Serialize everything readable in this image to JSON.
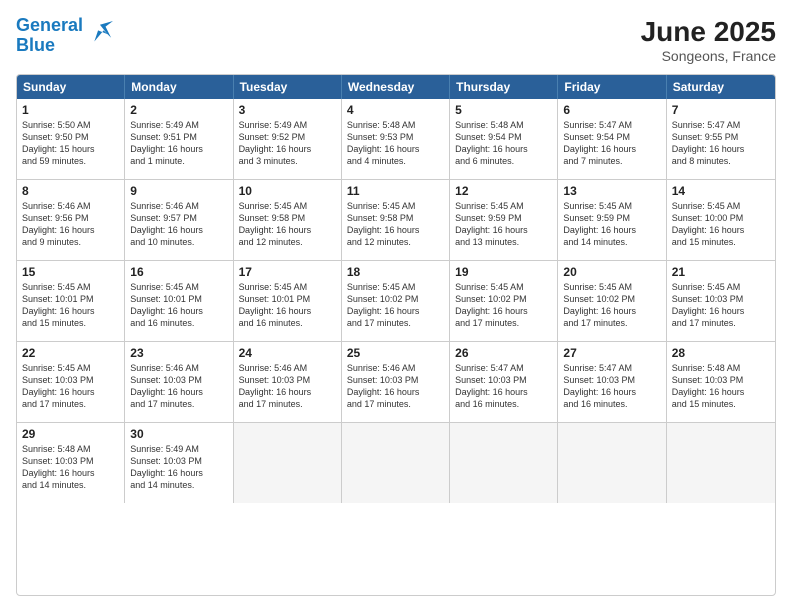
{
  "header": {
    "logo_line1": "General",
    "logo_line2": "Blue",
    "month": "June 2025",
    "location": "Songeons, France"
  },
  "days_of_week": [
    "Sunday",
    "Monday",
    "Tuesday",
    "Wednesday",
    "Thursday",
    "Friday",
    "Saturday"
  ],
  "weeks": [
    [
      {
        "day": "1",
        "lines": [
          "Sunrise: 5:50 AM",
          "Sunset: 9:50 PM",
          "Daylight: 15 hours",
          "and 59 minutes."
        ]
      },
      {
        "day": "2",
        "lines": [
          "Sunrise: 5:49 AM",
          "Sunset: 9:51 PM",
          "Daylight: 16 hours",
          "and 1 minute."
        ]
      },
      {
        "day": "3",
        "lines": [
          "Sunrise: 5:49 AM",
          "Sunset: 9:52 PM",
          "Daylight: 16 hours",
          "and 3 minutes."
        ]
      },
      {
        "day": "4",
        "lines": [
          "Sunrise: 5:48 AM",
          "Sunset: 9:53 PM",
          "Daylight: 16 hours",
          "and 4 minutes."
        ]
      },
      {
        "day": "5",
        "lines": [
          "Sunrise: 5:48 AM",
          "Sunset: 9:54 PM",
          "Daylight: 16 hours",
          "and 6 minutes."
        ]
      },
      {
        "day": "6",
        "lines": [
          "Sunrise: 5:47 AM",
          "Sunset: 9:54 PM",
          "Daylight: 16 hours",
          "and 7 minutes."
        ]
      },
      {
        "day": "7",
        "lines": [
          "Sunrise: 5:47 AM",
          "Sunset: 9:55 PM",
          "Daylight: 16 hours",
          "and 8 minutes."
        ]
      }
    ],
    [
      {
        "day": "8",
        "lines": [
          "Sunrise: 5:46 AM",
          "Sunset: 9:56 PM",
          "Daylight: 16 hours",
          "and 9 minutes."
        ]
      },
      {
        "day": "9",
        "lines": [
          "Sunrise: 5:46 AM",
          "Sunset: 9:57 PM",
          "Daylight: 16 hours",
          "and 10 minutes."
        ]
      },
      {
        "day": "10",
        "lines": [
          "Sunrise: 5:45 AM",
          "Sunset: 9:58 PM",
          "Daylight: 16 hours",
          "and 12 minutes."
        ]
      },
      {
        "day": "11",
        "lines": [
          "Sunrise: 5:45 AM",
          "Sunset: 9:58 PM",
          "Daylight: 16 hours",
          "and 12 minutes."
        ]
      },
      {
        "day": "12",
        "lines": [
          "Sunrise: 5:45 AM",
          "Sunset: 9:59 PM",
          "Daylight: 16 hours",
          "and 13 minutes."
        ]
      },
      {
        "day": "13",
        "lines": [
          "Sunrise: 5:45 AM",
          "Sunset: 9:59 PM",
          "Daylight: 16 hours",
          "and 14 minutes."
        ]
      },
      {
        "day": "14",
        "lines": [
          "Sunrise: 5:45 AM",
          "Sunset: 10:00 PM",
          "Daylight: 16 hours",
          "and 15 minutes."
        ]
      }
    ],
    [
      {
        "day": "15",
        "lines": [
          "Sunrise: 5:45 AM",
          "Sunset: 10:01 PM",
          "Daylight: 16 hours",
          "and 15 minutes."
        ]
      },
      {
        "day": "16",
        "lines": [
          "Sunrise: 5:45 AM",
          "Sunset: 10:01 PM",
          "Daylight: 16 hours",
          "and 16 minutes."
        ]
      },
      {
        "day": "17",
        "lines": [
          "Sunrise: 5:45 AM",
          "Sunset: 10:01 PM",
          "Daylight: 16 hours",
          "and 16 minutes."
        ]
      },
      {
        "day": "18",
        "lines": [
          "Sunrise: 5:45 AM",
          "Sunset: 10:02 PM",
          "Daylight: 16 hours",
          "and 17 minutes."
        ]
      },
      {
        "day": "19",
        "lines": [
          "Sunrise: 5:45 AM",
          "Sunset: 10:02 PM",
          "Daylight: 16 hours",
          "and 17 minutes."
        ]
      },
      {
        "day": "20",
        "lines": [
          "Sunrise: 5:45 AM",
          "Sunset: 10:02 PM",
          "Daylight: 16 hours",
          "and 17 minutes."
        ]
      },
      {
        "day": "21",
        "lines": [
          "Sunrise: 5:45 AM",
          "Sunset: 10:03 PM",
          "Daylight: 16 hours",
          "and 17 minutes."
        ]
      }
    ],
    [
      {
        "day": "22",
        "lines": [
          "Sunrise: 5:45 AM",
          "Sunset: 10:03 PM",
          "Daylight: 16 hours",
          "and 17 minutes."
        ]
      },
      {
        "day": "23",
        "lines": [
          "Sunrise: 5:46 AM",
          "Sunset: 10:03 PM",
          "Daylight: 16 hours",
          "and 17 minutes."
        ]
      },
      {
        "day": "24",
        "lines": [
          "Sunrise: 5:46 AM",
          "Sunset: 10:03 PM",
          "Daylight: 16 hours",
          "and 17 minutes."
        ]
      },
      {
        "day": "25",
        "lines": [
          "Sunrise: 5:46 AM",
          "Sunset: 10:03 PM",
          "Daylight: 16 hours",
          "and 17 minutes."
        ]
      },
      {
        "day": "26",
        "lines": [
          "Sunrise: 5:47 AM",
          "Sunset: 10:03 PM",
          "Daylight: 16 hours",
          "and 16 minutes."
        ]
      },
      {
        "day": "27",
        "lines": [
          "Sunrise: 5:47 AM",
          "Sunset: 10:03 PM",
          "Daylight: 16 hours",
          "and 16 minutes."
        ]
      },
      {
        "day": "28",
        "lines": [
          "Sunrise: 5:48 AM",
          "Sunset: 10:03 PM",
          "Daylight: 16 hours",
          "and 15 minutes."
        ]
      }
    ],
    [
      {
        "day": "29",
        "lines": [
          "Sunrise: 5:48 AM",
          "Sunset: 10:03 PM",
          "Daylight: 16 hours",
          "and 14 minutes."
        ]
      },
      {
        "day": "30",
        "lines": [
          "Sunrise: 5:49 AM",
          "Sunset: 10:03 PM",
          "Daylight: 16 hours",
          "and 14 minutes."
        ]
      },
      {
        "day": "",
        "lines": []
      },
      {
        "day": "",
        "lines": []
      },
      {
        "day": "",
        "lines": []
      },
      {
        "day": "",
        "lines": []
      },
      {
        "day": "",
        "lines": []
      }
    ]
  ]
}
